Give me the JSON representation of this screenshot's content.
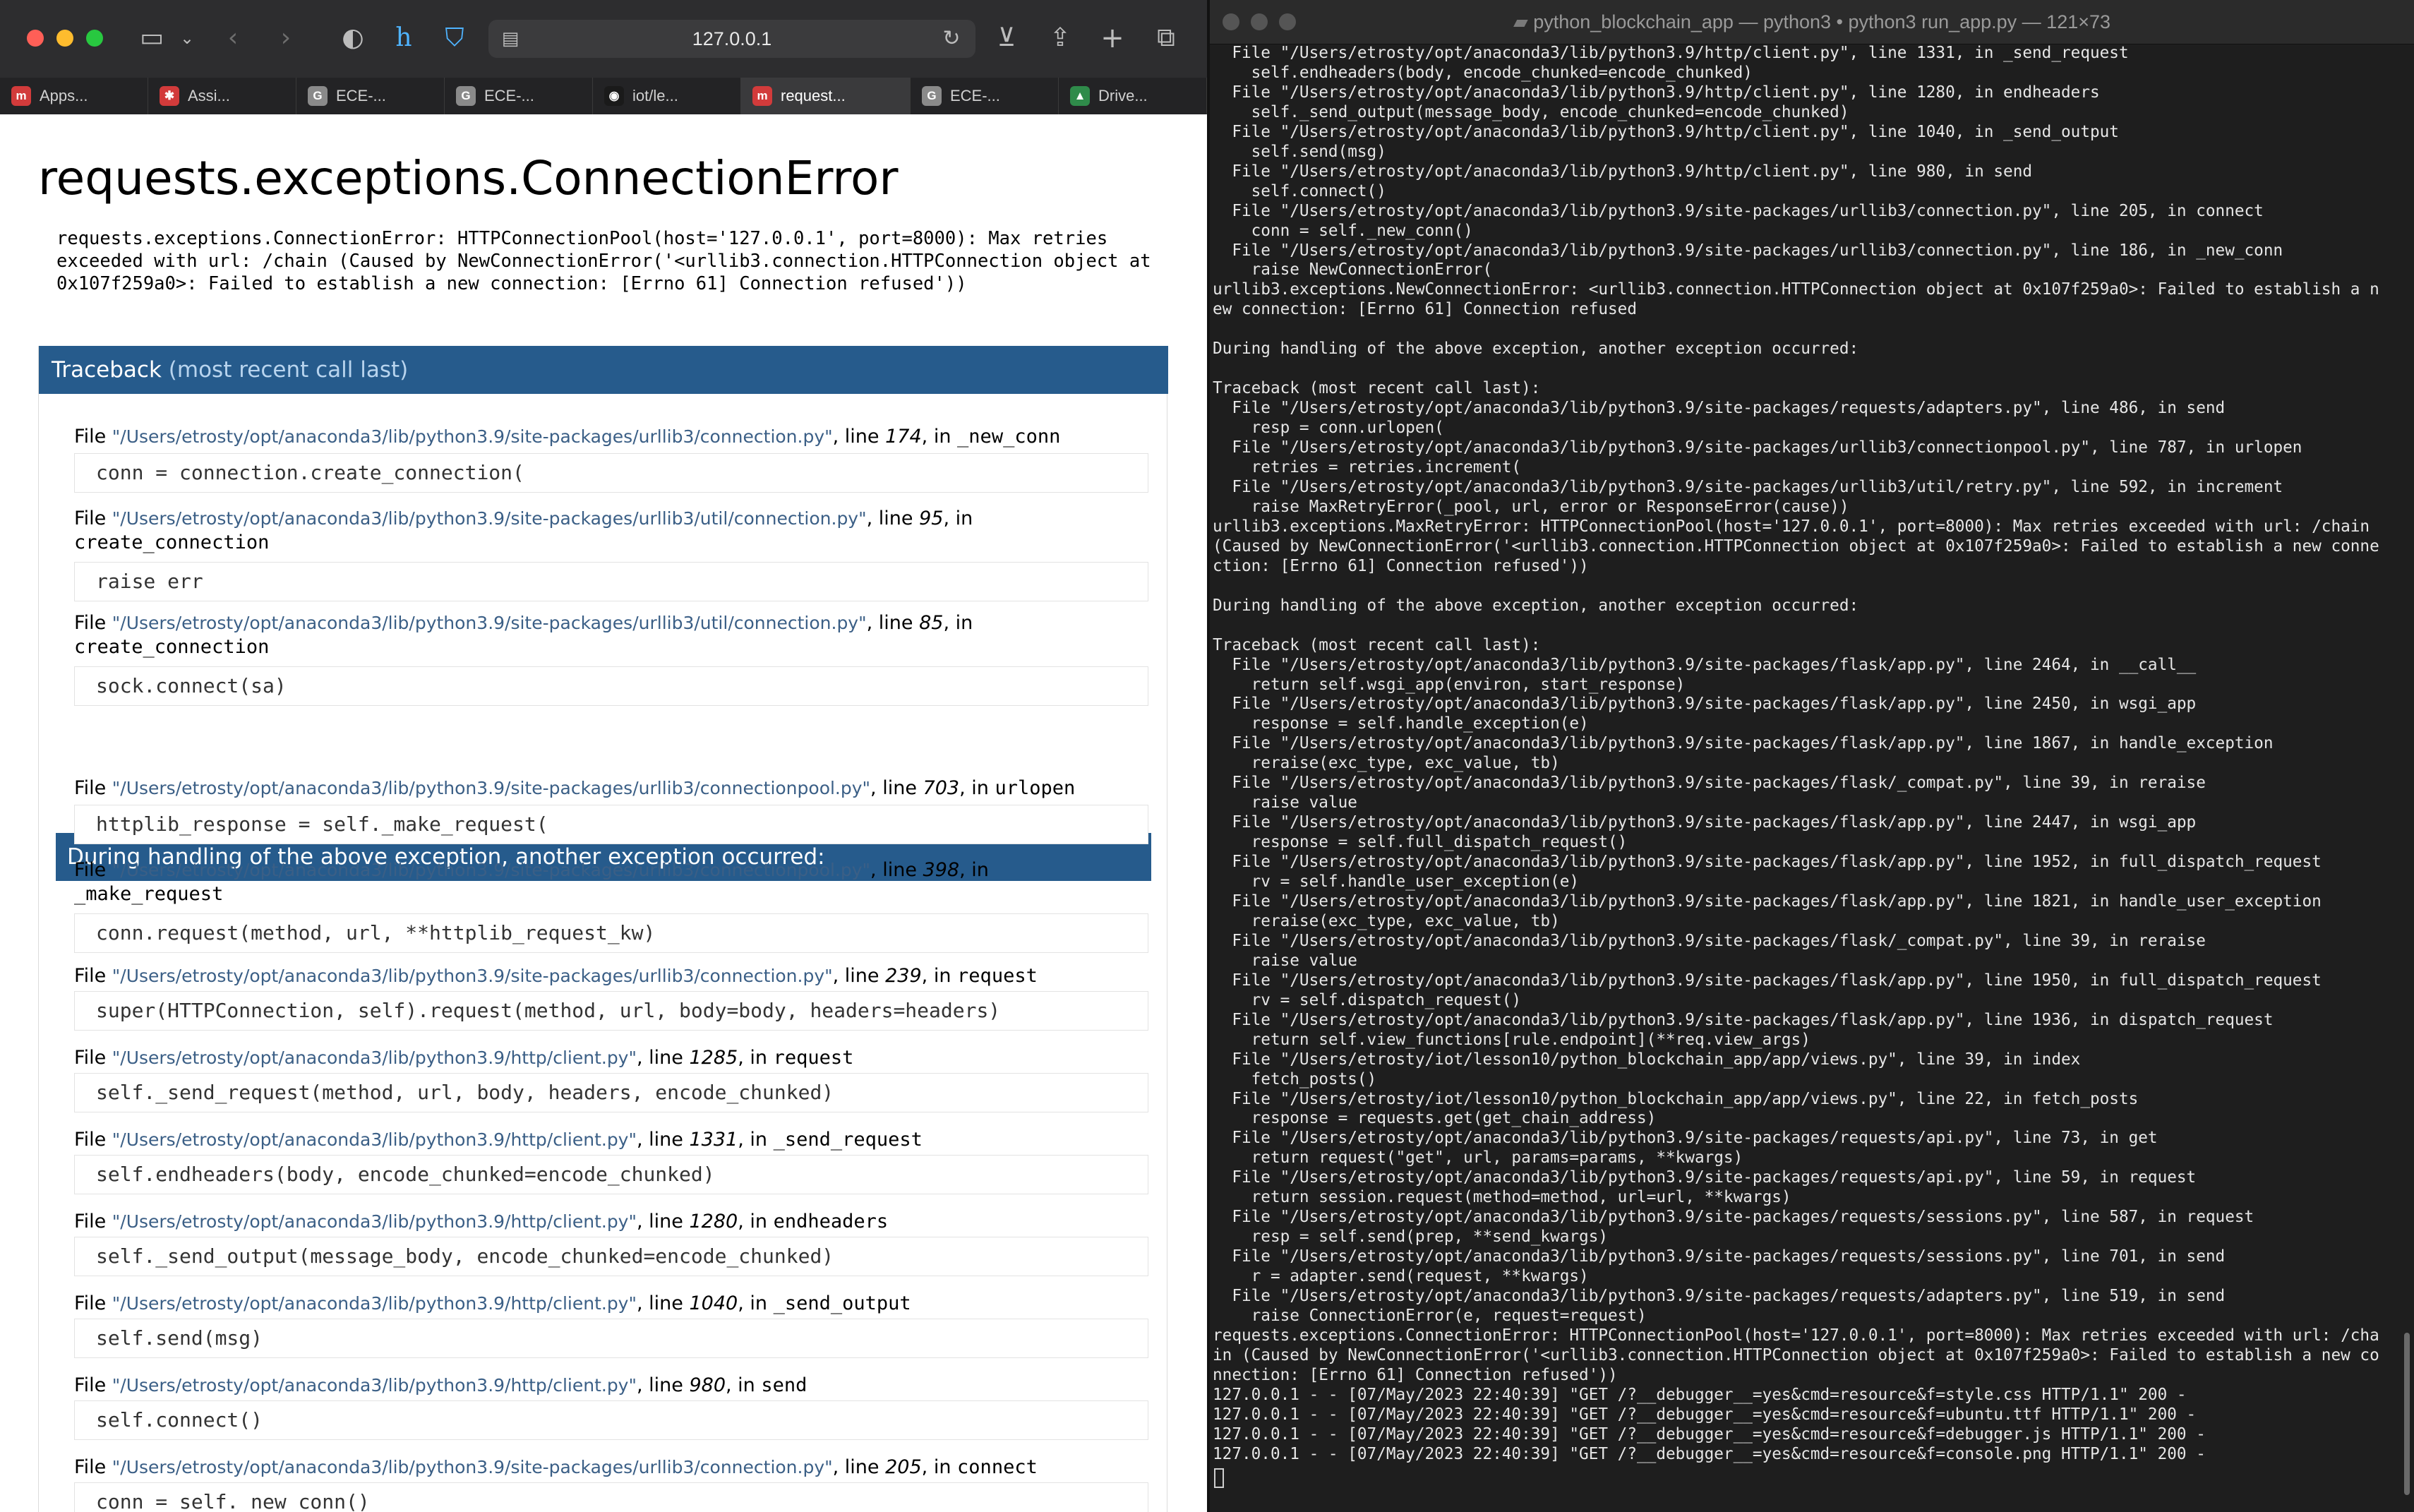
{
  "browser": {
    "url": "127.0.0.1",
    "tabs": [
      {
        "label": "Apps...",
        "icon": "m",
        "color": "#d23b3b",
        "active": false
      },
      {
        "label": "Assi...",
        "icon": "✱",
        "color": "#d23b3b",
        "active": false
      },
      {
        "label": "ECE-...",
        "icon": "G",
        "color": "#8a8a8a",
        "active": false
      },
      {
        "label": "ECE-...",
        "icon": "G",
        "color": "#8a8a8a",
        "active": false
      },
      {
        "label": "iot/le...",
        "icon": "◉",
        "color": "#1a1a1a",
        "active": false
      },
      {
        "label": "request...",
        "icon": "m",
        "color": "#d23b3b",
        "active": true
      },
      {
        "label": "ECE-...",
        "icon": "G",
        "color": "#8a8a8a",
        "active": false
      },
      {
        "label": "Drive...",
        "icon": "▲",
        "color": "#2f8b4a",
        "active": false
      }
    ]
  },
  "page": {
    "title": "requests.exceptions.ConnectionError",
    "message": "requests.exceptions.ConnectionError: HTTPConnectionPool(host='127.0.0.1', port=8000): Max retries exceeded with url: /chain (Caused by NewConnectionError('<urllib3.connection.HTTPConnection object at 0x107f259a0>: Failed to establish a new connection: [Errno 61] Connection refused'))",
    "traceback_header": "Traceback",
    "traceback_sub": "(most recent call last)",
    "handling_header": "During handling of the above exception, another exception occurred:",
    "frames": [
      {
        "path": "\"/Users/etrosty/opt/anaconda3/lib/python3.9/site-packages/urllib3/connection.py\"",
        "line": "174",
        "fn": "_new_conn",
        "code": "conn = connection.create_connection("
      },
      {
        "path": "\"/Users/etrosty/opt/anaconda3/lib/python3.9/site-packages/urllib3/util/connection.py\"",
        "line": "95",
        "fn": "create_connection",
        "code": "raise err"
      },
      {
        "path": "\"/Users/etrosty/opt/anaconda3/lib/python3.9/site-packages/urllib3/util/connection.py\"",
        "line": "85",
        "fn": "create_connection",
        "code": "sock.connect(sa)"
      },
      {
        "path": "\"/Users/etrosty/opt/anaconda3/lib/python3.9/site-packages/urllib3/connectionpool.py\"",
        "line": "703",
        "fn": "urlopen",
        "code": "httplib_response = self._make_request("
      },
      {
        "path": "\"/Users/etrosty/opt/anaconda3/lib/python3.9/site-packages/urllib3/connectionpool.py\"",
        "line": "398",
        "fn": "_make_request",
        "code": "conn.request(method, url, **httplib_request_kw)"
      },
      {
        "path": "\"/Users/etrosty/opt/anaconda3/lib/python3.9/site-packages/urllib3/connection.py\"",
        "line": "239",
        "fn": "request",
        "code": "super(HTTPConnection, self).request(method, url, body=body, headers=headers)"
      },
      {
        "path": "\"/Users/etrosty/opt/anaconda3/lib/python3.9/http/client.py\"",
        "line": "1285",
        "fn": "request",
        "code": "self._send_request(method, url, body, headers, encode_chunked)"
      },
      {
        "path": "\"/Users/etrosty/opt/anaconda3/lib/python3.9/http/client.py\"",
        "line": "1331",
        "fn": "_send_request",
        "code": "self.endheaders(body, encode_chunked=encode_chunked)"
      },
      {
        "path": "\"/Users/etrosty/opt/anaconda3/lib/python3.9/http/client.py\"",
        "line": "1280",
        "fn": "endheaders",
        "code": "self._send_output(message_body, encode_chunked=encode_chunked)"
      },
      {
        "path": "\"/Users/etrosty/opt/anaconda3/lib/python3.9/http/client.py\"",
        "line": "1040",
        "fn": "_send_output",
        "code": "self.send(msg)"
      },
      {
        "path": "\"/Users/etrosty/opt/anaconda3/lib/python3.9/http/client.py\"",
        "line": "980",
        "fn": "send",
        "code": "self.connect()"
      },
      {
        "path": "\"/Users/etrosty/opt/anaconda3/lib/python3.9/site-packages/urllib3/connection.py\"",
        "line": "205",
        "fn": "connect",
        "code": "conn = self._new_conn()"
      }
    ]
  },
  "terminal": {
    "title": "python_blockchain_app — python3 • python3 run_app.py — 121×73",
    "lines": [
      "  File \"/Users/etrosty/opt/anaconda3/lib/python3.9/http/client.py\", line 1331, in _send_request",
      "    self.endheaders(body, encode_chunked=encode_chunked)",
      "  File \"/Users/etrosty/opt/anaconda3/lib/python3.9/http/client.py\", line 1280, in endheaders",
      "    self._send_output(message_body, encode_chunked=encode_chunked)",
      "  File \"/Users/etrosty/opt/anaconda3/lib/python3.9/http/client.py\", line 1040, in _send_output",
      "    self.send(msg)",
      "  File \"/Users/etrosty/opt/anaconda3/lib/python3.9/http/client.py\", line 980, in send",
      "    self.connect()",
      "  File \"/Users/etrosty/opt/anaconda3/lib/python3.9/site-packages/urllib3/connection.py\", line 205, in connect",
      "    conn = self._new_conn()",
      "  File \"/Users/etrosty/opt/anaconda3/lib/python3.9/site-packages/urllib3/connection.py\", line 186, in _new_conn",
      "    raise NewConnectionError(",
      "urllib3.exceptions.NewConnectionError: <urllib3.connection.HTTPConnection object at 0x107f259a0>: Failed to establish a n",
      "ew connection: [Errno 61] Connection refused",
      "",
      "During handling of the above exception, another exception occurred:",
      "",
      "Traceback (most recent call last):",
      "  File \"/Users/etrosty/opt/anaconda3/lib/python3.9/site-packages/requests/adapters.py\", line 486, in send",
      "    resp = conn.urlopen(",
      "  File \"/Users/etrosty/opt/anaconda3/lib/python3.9/site-packages/urllib3/connectionpool.py\", line 787, in urlopen",
      "    retries = retries.increment(",
      "  File \"/Users/etrosty/opt/anaconda3/lib/python3.9/site-packages/urllib3/util/retry.py\", line 592, in increment",
      "    raise MaxRetryError(_pool, url, error or ResponseError(cause))",
      "urllib3.exceptions.MaxRetryError: HTTPConnectionPool(host='127.0.0.1', port=8000): Max retries exceeded with url: /chain",
      "(Caused by NewConnectionError('<urllib3.connection.HTTPConnection object at 0x107f259a0>: Failed to establish a new conne",
      "ction: [Errno 61] Connection refused'))",
      "",
      "During handling of the above exception, another exception occurred:",
      "",
      "Traceback (most recent call last):",
      "  File \"/Users/etrosty/opt/anaconda3/lib/python3.9/site-packages/flask/app.py\", line 2464, in __call__",
      "    return self.wsgi_app(environ, start_response)",
      "  File \"/Users/etrosty/opt/anaconda3/lib/python3.9/site-packages/flask/app.py\", line 2450, in wsgi_app",
      "    response = self.handle_exception(e)",
      "  File \"/Users/etrosty/opt/anaconda3/lib/python3.9/site-packages/flask/app.py\", line 1867, in handle_exception",
      "    reraise(exc_type, exc_value, tb)",
      "  File \"/Users/etrosty/opt/anaconda3/lib/python3.9/site-packages/flask/_compat.py\", line 39, in reraise",
      "    raise value",
      "  File \"/Users/etrosty/opt/anaconda3/lib/python3.9/site-packages/flask/app.py\", line 2447, in wsgi_app",
      "    response = self.full_dispatch_request()",
      "  File \"/Users/etrosty/opt/anaconda3/lib/python3.9/site-packages/flask/app.py\", line 1952, in full_dispatch_request",
      "    rv = self.handle_user_exception(e)",
      "  File \"/Users/etrosty/opt/anaconda3/lib/python3.9/site-packages/flask/app.py\", line 1821, in handle_user_exception",
      "    reraise(exc_type, exc_value, tb)",
      "  File \"/Users/etrosty/opt/anaconda3/lib/python3.9/site-packages/flask/_compat.py\", line 39, in reraise",
      "    raise value",
      "  File \"/Users/etrosty/opt/anaconda3/lib/python3.9/site-packages/flask/app.py\", line 1950, in full_dispatch_request",
      "    rv = self.dispatch_request()",
      "  File \"/Users/etrosty/opt/anaconda3/lib/python3.9/site-packages/flask/app.py\", line 1936, in dispatch_request",
      "    return self.view_functions[rule.endpoint](**req.view_args)",
      "  File \"/Users/etrosty/iot/lesson10/python_blockchain_app/app/views.py\", line 39, in index",
      "    fetch_posts()",
      "  File \"/Users/etrosty/iot/lesson10/python_blockchain_app/app/views.py\", line 22, in fetch_posts",
      "    response = requests.get(get_chain_address)",
      "  File \"/Users/etrosty/opt/anaconda3/lib/python3.9/site-packages/requests/api.py\", line 73, in get",
      "    return request(\"get\", url, params=params, **kwargs)",
      "  File \"/Users/etrosty/opt/anaconda3/lib/python3.9/site-packages/requests/api.py\", line 59, in request",
      "    return session.request(method=method, url=url, **kwargs)",
      "  File \"/Users/etrosty/opt/anaconda3/lib/python3.9/site-packages/requests/sessions.py\", line 587, in request",
      "    resp = self.send(prep, **send_kwargs)",
      "  File \"/Users/etrosty/opt/anaconda3/lib/python3.9/site-packages/requests/sessions.py\", line 701, in send",
      "    r = adapter.send(request, **kwargs)",
      "  File \"/Users/etrosty/opt/anaconda3/lib/python3.9/site-packages/requests/adapters.py\", line 519, in send",
      "    raise ConnectionError(e, request=request)",
      "requests.exceptions.ConnectionError: HTTPConnectionPool(host='127.0.0.1', port=8000): Max retries exceeded with url: /cha",
      "in (Caused by NewConnectionError('<urllib3.connection.HTTPConnection object at 0x107f259a0>: Failed to establish a new co",
      "nnection: [Errno 61] Connection refused'))",
      "127.0.0.1 - - [07/May/2023 22:40:39] \"GET /?__debugger__=yes&cmd=resource&f=style.css HTTP/1.1\" 200 -",
      "127.0.0.1 - - [07/May/2023 22:40:39] \"GET /?__debugger__=yes&cmd=resource&f=ubuntu.ttf HTTP/1.1\" 200 -",
      "127.0.0.1 - - [07/May/2023 22:40:39] \"GET /?__debugger__=yes&cmd=resource&f=debugger.js HTTP/1.1\" 200 -",
      "127.0.0.1 - - [07/May/2023 22:40:39] \"GET /?__debugger__=yes&cmd=resource&f=console.png HTTP/1.1\" 200 -"
    ]
  },
  "colors": {
    "traceback_header": "#265b8c",
    "terminal_bg": "#1e1e1e",
    "path_link": "#3b5f86"
  }
}
